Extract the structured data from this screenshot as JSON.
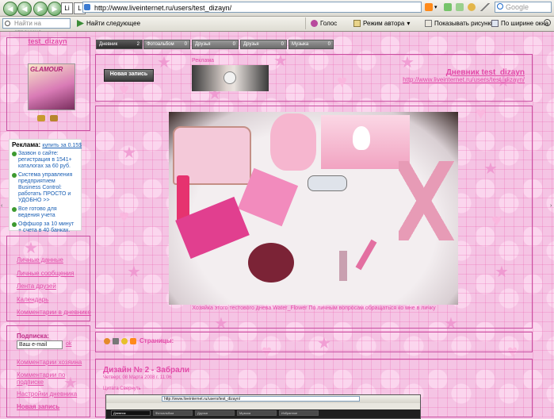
{
  "browser": {
    "url": "http://www.liveinternet.ru/users/test_dizayn/",
    "search_placeholder": "Google",
    "find_placeholder": "Найти на странице",
    "find_next": "Найти следующее",
    "voice": "Голос",
    "author_mode": "Режим автора",
    "show_images": "Показывать рисунки",
    "fit_width": "По ширине окна"
  },
  "tabs": [
    {
      "label": "Дневник",
      "count": "2"
    },
    {
      "label": "Фотоальбом",
      "count": "0"
    },
    {
      "label": "Друзья",
      "count": "0"
    },
    {
      "label": "Друзья",
      "count": "0"
    },
    {
      "label": "Музыка",
      "count": "0"
    }
  ],
  "sidebar": {
    "username": "test_dizayn",
    "avatar_text": "GLAMOUR",
    "ad_label": "Реклама:",
    "ad_buy": "купить за 0.15$",
    "ads": [
      "Зазвон о сайте: регистрация в 1541+ каталогах за 60 руб.",
      "Система управления предприятием Business Control: работать ПРОСТО и УДОБНО >>",
      "Все готово для ведения учета",
      "Оффшор за 10 минут + счета в 40 банках."
    ],
    "links": [
      "Личные данные",
      "Личные сообщения",
      "Лента друзей",
      "Календарь",
      "Комментарии в дневнике"
    ],
    "subscribe_label": "Подписка:",
    "email_placeholder": "Ваш e-mail",
    "subscribe_ok": "ok",
    "links2": [
      "Комментарии хозяина",
      "Комментарии по подписке",
      "Настройки дневника",
      "Новая запись"
    ]
  },
  "main": {
    "new_post": "Новая запись",
    "ad_label": "Реклама",
    "diary_title": "Дневник test_dizayn",
    "diary_url": "http://www.liveinternet.ru/users/test_dizayn/",
    "photo_caption": "Хозяйка этого тестового дневa Water_Flower По личным вопросам обращаться ко мне в личку",
    "pages_label": "Страницы:",
    "post_title": "Дизайн № 2 - Забрали",
    "post_meta": "Четверг, 08 Марта 2008 г. 11:06",
    "post_meta2": "Цитата  Свернуть",
    "embed_url": "http://www.liveinternet.ru/users/test_dizayn/",
    "embed_tabs": [
      "Дневник",
      "Фотоальбом",
      "Друзья",
      "Музыка",
      "Избранное"
    ]
  },
  "colors": {
    "accent": "#e24aa8",
    "bg": "#f5c4e4"
  }
}
